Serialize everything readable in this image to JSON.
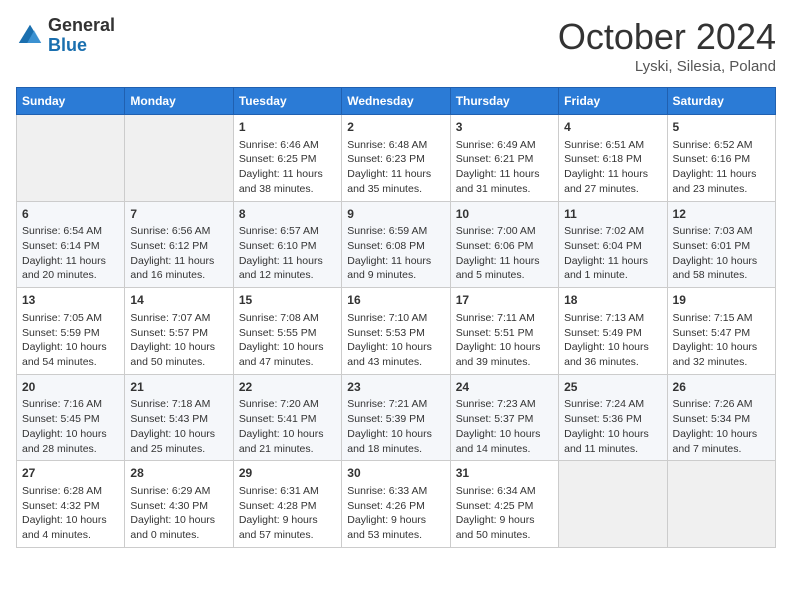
{
  "header": {
    "logo_general": "General",
    "logo_blue": "Blue",
    "month_title": "October 2024",
    "location": "Lyski, Silesia, Poland"
  },
  "days_of_week": [
    "Sunday",
    "Monday",
    "Tuesday",
    "Wednesday",
    "Thursday",
    "Friday",
    "Saturday"
  ],
  "weeks": [
    [
      {
        "day": "",
        "content": ""
      },
      {
        "day": "",
        "content": ""
      },
      {
        "day": "1",
        "content": "Sunrise: 6:46 AM\nSunset: 6:25 PM\nDaylight: 11 hours and 38 minutes."
      },
      {
        "day": "2",
        "content": "Sunrise: 6:48 AM\nSunset: 6:23 PM\nDaylight: 11 hours and 35 minutes."
      },
      {
        "day": "3",
        "content": "Sunrise: 6:49 AM\nSunset: 6:21 PM\nDaylight: 11 hours and 31 minutes."
      },
      {
        "day": "4",
        "content": "Sunrise: 6:51 AM\nSunset: 6:18 PM\nDaylight: 11 hours and 27 minutes."
      },
      {
        "day": "5",
        "content": "Sunrise: 6:52 AM\nSunset: 6:16 PM\nDaylight: 11 hours and 23 minutes."
      }
    ],
    [
      {
        "day": "6",
        "content": "Sunrise: 6:54 AM\nSunset: 6:14 PM\nDaylight: 11 hours and 20 minutes."
      },
      {
        "day": "7",
        "content": "Sunrise: 6:56 AM\nSunset: 6:12 PM\nDaylight: 11 hours and 16 minutes."
      },
      {
        "day": "8",
        "content": "Sunrise: 6:57 AM\nSunset: 6:10 PM\nDaylight: 11 hours and 12 minutes."
      },
      {
        "day": "9",
        "content": "Sunrise: 6:59 AM\nSunset: 6:08 PM\nDaylight: 11 hours and 9 minutes."
      },
      {
        "day": "10",
        "content": "Sunrise: 7:00 AM\nSunset: 6:06 PM\nDaylight: 11 hours and 5 minutes."
      },
      {
        "day": "11",
        "content": "Sunrise: 7:02 AM\nSunset: 6:04 PM\nDaylight: 11 hours and 1 minute."
      },
      {
        "day": "12",
        "content": "Sunrise: 7:03 AM\nSunset: 6:01 PM\nDaylight: 10 hours and 58 minutes."
      }
    ],
    [
      {
        "day": "13",
        "content": "Sunrise: 7:05 AM\nSunset: 5:59 PM\nDaylight: 10 hours and 54 minutes."
      },
      {
        "day": "14",
        "content": "Sunrise: 7:07 AM\nSunset: 5:57 PM\nDaylight: 10 hours and 50 minutes."
      },
      {
        "day": "15",
        "content": "Sunrise: 7:08 AM\nSunset: 5:55 PM\nDaylight: 10 hours and 47 minutes."
      },
      {
        "day": "16",
        "content": "Sunrise: 7:10 AM\nSunset: 5:53 PM\nDaylight: 10 hours and 43 minutes."
      },
      {
        "day": "17",
        "content": "Sunrise: 7:11 AM\nSunset: 5:51 PM\nDaylight: 10 hours and 39 minutes."
      },
      {
        "day": "18",
        "content": "Sunrise: 7:13 AM\nSunset: 5:49 PM\nDaylight: 10 hours and 36 minutes."
      },
      {
        "day": "19",
        "content": "Sunrise: 7:15 AM\nSunset: 5:47 PM\nDaylight: 10 hours and 32 minutes."
      }
    ],
    [
      {
        "day": "20",
        "content": "Sunrise: 7:16 AM\nSunset: 5:45 PM\nDaylight: 10 hours and 28 minutes."
      },
      {
        "day": "21",
        "content": "Sunrise: 7:18 AM\nSunset: 5:43 PM\nDaylight: 10 hours and 25 minutes."
      },
      {
        "day": "22",
        "content": "Sunrise: 7:20 AM\nSunset: 5:41 PM\nDaylight: 10 hours and 21 minutes."
      },
      {
        "day": "23",
        "content": "Sunrise: 7:21 AM\nSunset: 5:39 PM\nDaylight: 10 hours and 18 minutes."
      },
      {
        "day": "24",
        "content": "Sunrise: 7:23 AM\nSunset: 5:37 PM\nDaylight: 10 hours and 14 minutes."
      },
      {
        "day": "25",
        "content": "Sunrise: 7:24 AM\nSunset: 5:36 PM\nDaylight: 10 hours and 11 minutes."
      },
      {
        "day": "26",
        "content": "Sunrise: 7:26 AM\nSunset: 5:34 PM\nDaylight: 10 hours and 7 minutes."
      }
    ],
    [
      {
        "day": "27",
        "content": "Sunrise: 6:28 AM\nSunset: 4:32 PM\nDaylight: 10 hours and 4 minutes."
      },
      {
        "day": "28",
        "content": "Sunrise: 6:29 AM\nSunset: 4:30 PM\nDaylight: 10 hours and 0 minutes."
      },
      {
        "day": "29",
        "content": "Sunrise: 6:31 AM\nSunset: 4:28 PM\nDaylight: 9 hours and 57 minutes."
      },
      {
        "day": "30",
        "content": "Sunrise: 6:33 AM\nSunset: 4:26 PM\nDaylight: 9 hours and 53 minutes."
      },
      {
        "day": "31",
        "content": "Sunrise: 6:34 AM\nSunset: 4:25 PM\nDaylight: 9 hours and 50 minutes."
      },
      {
        "day": "",
        "content": ""
      },
      {
        "day": "",
        "content": ""
      }
    ]
  ]
}
